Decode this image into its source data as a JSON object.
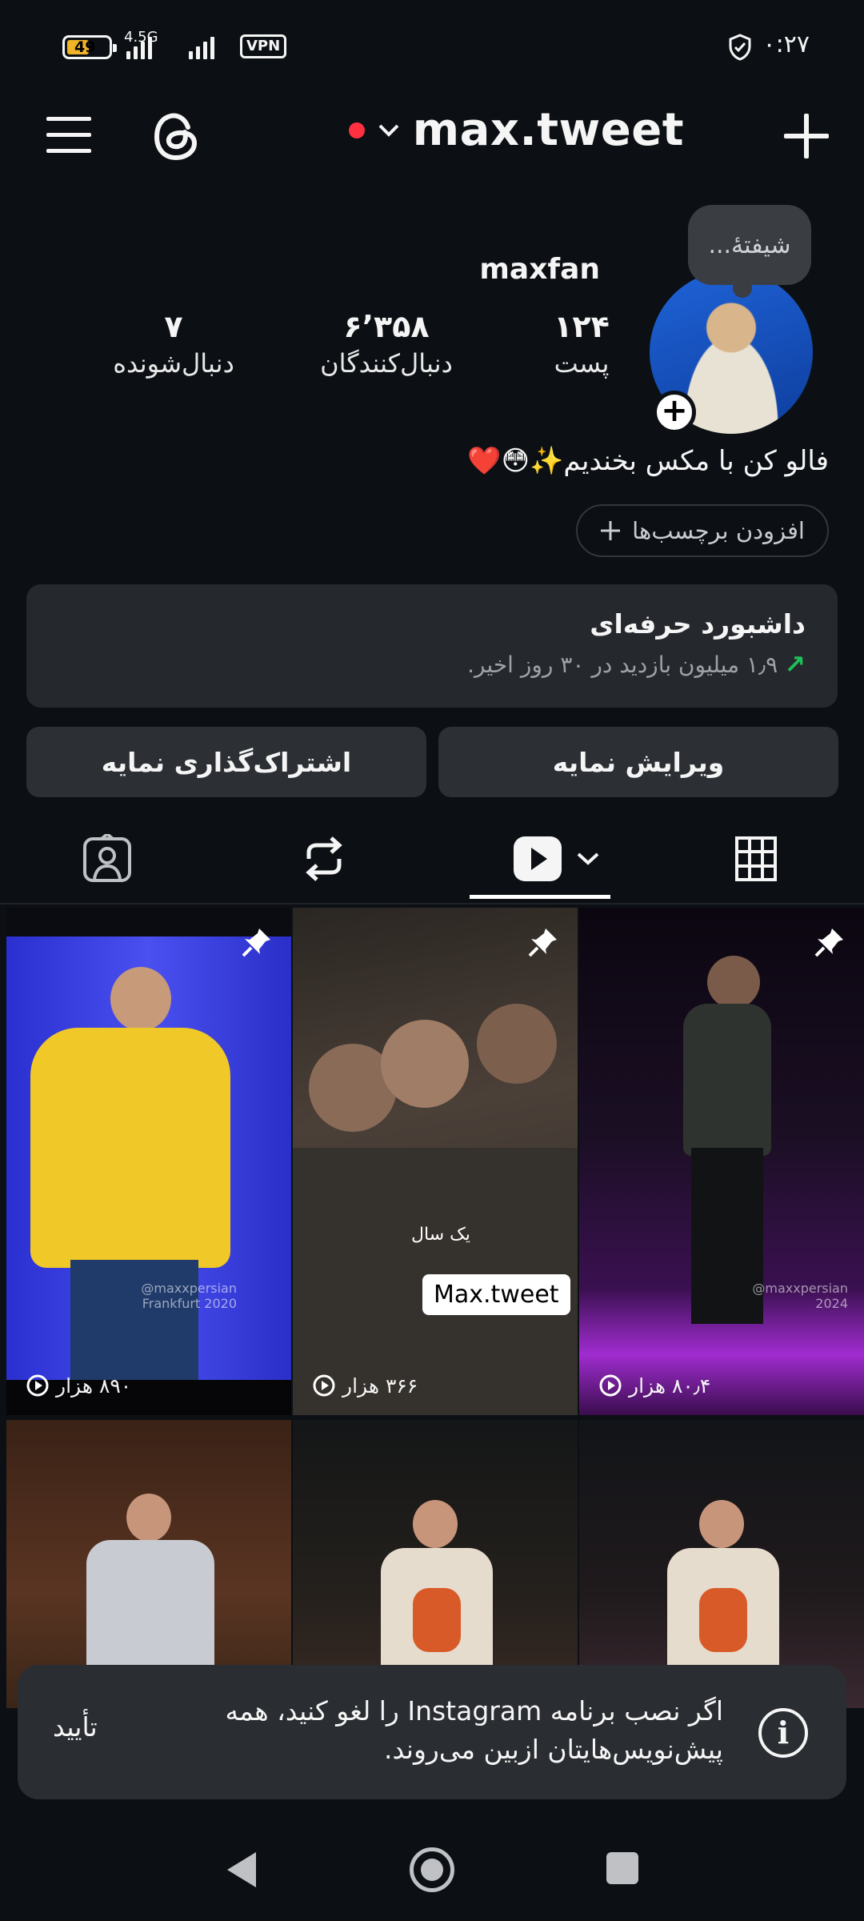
{
  "status_bar": {
    "battery_level": "49",
    "network": "4.5G",
    "vpn": "VPN",
    "time": "۰:۲۷"
  },
  "header": {
    "username": "max.tweet",
    "menu_icon": "hamburger-icon",
    "threads_icon": "threads-icon",
    "add_icon": "plus-icon"
  },
  "profile": {
    "note": "شیفتهٔ...",
    "display_name": "maxfan",
    "stats": [
      {
        "value": "۱۲۴",
        "label": "پست"
      },
      {
        "value": "۶٬۳۵۸",
        "label": "دنبال‌کنندگان"
      },
      {
        "value": "۷",
        "label": "دنبال‌شونده"
      }
    ],
    "bio": "فالو کن با مکس بخندیم✨😳❤️",
    "add_tags": "افزودن برچسب‌ها"
  },
  "dashboard": {
    "title": "داشبورد حرفه‌ای",
    "subtitle": "۱٫۹ میلیون بازدید در ۳۰ روز اخیر."
  },
  "actions": {
    "edit": "ویرایش نمایه",
    "share": "اشتراک‌گذاری نمایه"
  },
  "tabs": [
    "grid-icon",
    "reels-icon",
    "reposts-icon",
    "tagged-icon"
  ],
  "grid": {
    "items": [
      {
        "views": "۸۰٫۴ هزار",
        "pinned": true,
        "watermark": "@maxxpersian 2024"
      },
      {
        "views": "۳۶۶ هزار",
        "pinned": true,
        "caption_small": "یک سال",
        "caption_box": "Max.tweet"
      },
      {
        "views": "۸۹۰ هزار",
        "pinned": true,
        "watermark": "@maxxpersian Frankfurt 2020"
      }
    ]
  },
  "toast": {
    "message": "اگر نصب برنامه Instagram را لغو کنید، همه پیش‌نویس‌هایتان ازبین می‌روند.",
    "confirm": "تأیید"
  },
  "colors": {
    "background": "#0c1014",
    "card": "#25282d",
    "accent_red": "#ff3040",
    "trend_green": "#1fbf5a"
  }
}
